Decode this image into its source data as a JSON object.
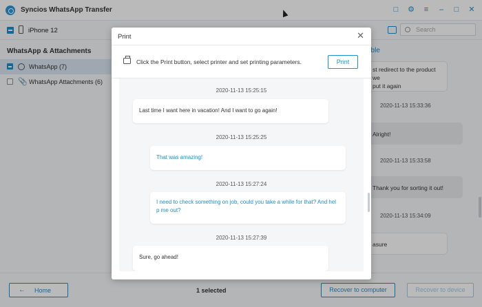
{
  "app": {
    "title": "Syncios WhatsApp Transfer"
  },
  "device": {
    "name": "iPhone 12"
  },
  "search": {
    "placeholder": "Search"
  },
  "sidebar": {
    "title": "WhatsApp & Attachments",
    "items": [
      {
        "label": "WhatsApp (7)",
        "checked": true
      },
      {
        "label": "WhatsApp Attachments (6)",
        "checked": false
      }
    ]
  },
  "background_chat": {
    "tab_label": "bble",
    "fragments": [
      {
        "text": "st redirect to the product we\nput it again"
      },
      {
        "time": "2020-11-13 15:33:36"
      },
      {
        "text": "Alright!"
      },
      {
        "time": "2020-11-13 15:33:58"
      },
      {
        "text": "Thank you for sorting it out!"
      },
      {
        "time": "2020-11-13 15:34:09"
      },
      {
        "text": "asure"
      }
    ]
  },
  "dialog": {
    "title": "Print",
    "close_icon": "close-icon",
    "instruction": "Click the Print button, select printer and set printing parameters.",
    "print_button": "Print",
    "messages": [
      {
        "time": "2020-11-13 15:25:15",
        "text": "Last time I want here in vacation! And I want to go again!",
        "direction": "in"
      },
      {
        "time": "2020-11-13 15:25:25",
        "text": "That was amazing!",
        "direction": "out"
      },
      {
        "time": "2020-11-13 15:27:24",
        "text": "I need to check something on job, could you take a while for that? And hel\np me out?",
        "direction": "out"
      },
      {
        "time": "2020-11-13 15:27:39",
        "text": "Sure, go ahead!",
        "direction": "in"
      }
    ]
  },
  "footer": {
    "home_button": "Home",
    "selected_text": "1 selected",
    "recover_computer": "Recover to computer",
    "recover_device": "Recover to device"
  },
  "colors": {
    "accent": "#1b8fd0",
    "overlay": "rgba(0,0,0,0.27)"
  }
}
